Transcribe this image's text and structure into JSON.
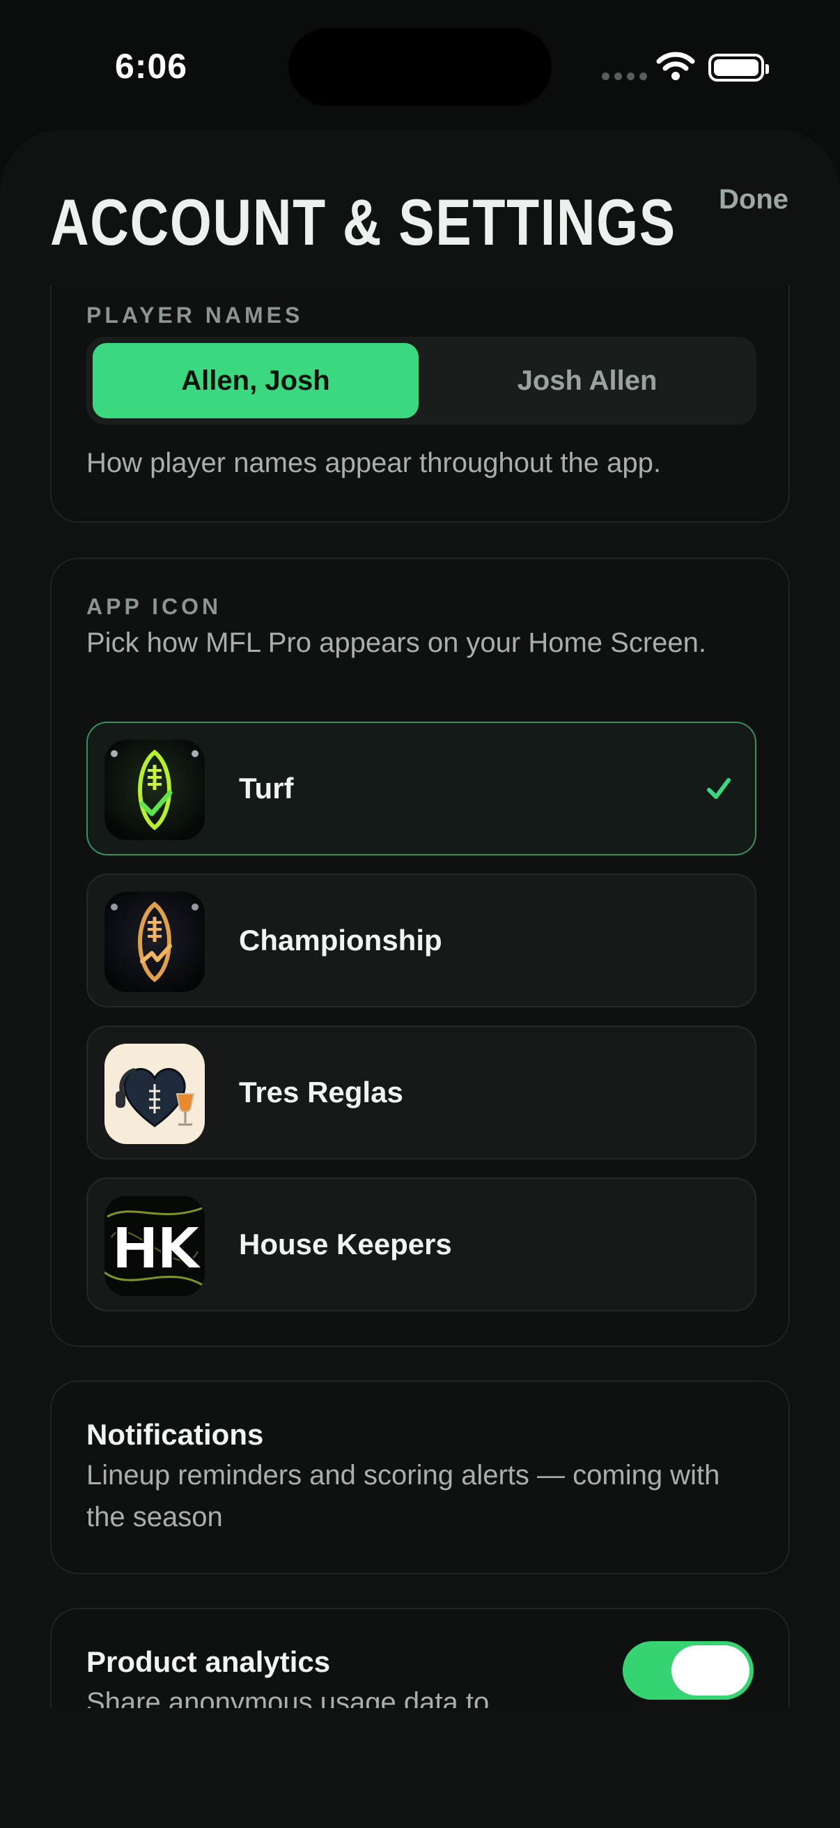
{
  "status_bar": {
    "time": "6:06"
  },
  "header": {
    "title": "ACCOUNT & SETTINGS",
    "done_label": "Done"
  },
  "player_names": {
    "label": "PLAYER NAMES",
    "options": [
      "Allen, Josh",
      "Josh Allen"
    ],
    "selected": "Allen, Josh",
    "helper": "How player names appear throughout the app."
  },
  "app_icon": {
    "label": "APP ICON",
    "helper": "Pick how MFL Pro appears on your Home Screen.",
    "options": [
      {
        "name": "Turf",
        "icon": "turf-football-icon",
        "selected": true
      },
      {
        "name": "Championship",
        "icon": "championship-football-icon",
        "selected": false
      },
      {
        "name": "Tres Reglas",
        "icon": "tres-reglas-heart-icon",
        "selected": false
      },
      {
        "name": "House Keepers",
        "icon": "house-keepers-hk-icon",
        "selected": false
      }
    ],
    "house_keepers_monogram": "HK"
  },
  "notifications": {
    "title": "Notifications",
    "description": "Lineup reminders and scoring alerts — coming with the season"
  },
  "product_analytics": {
    "title": "Product analytics",
    "description": "Share anonymous usage data to",
    "enabled": true
  },
  "colors": {
    "accent": "#3bd97f",
    "background": "#0b0d0c",
    "card": "#0e1110"
  }
}
